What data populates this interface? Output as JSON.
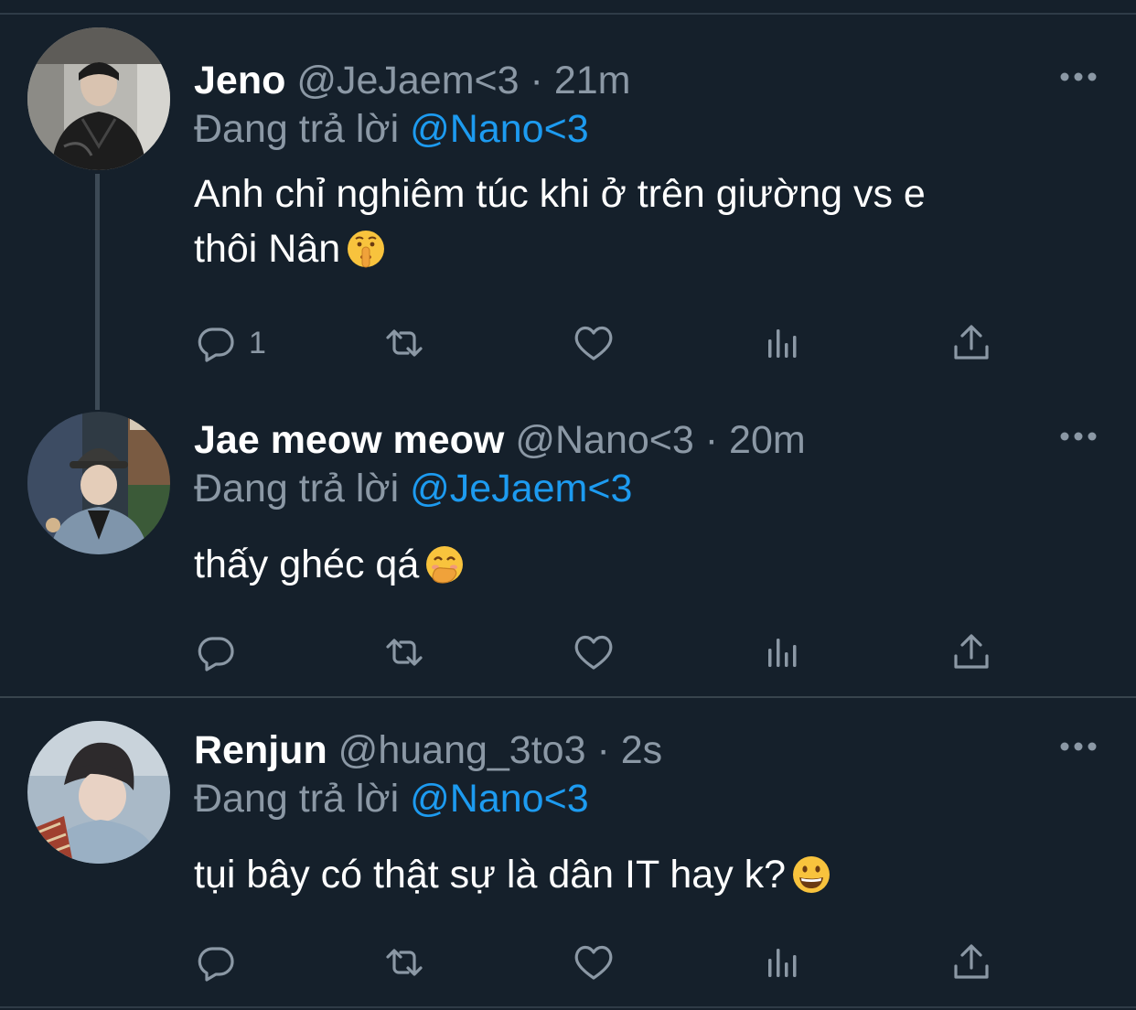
{
  "tweets": [
    {
      "name": "Jeno",
      "handle": "@JeJaem<3",
      "separator": "·",
      "time": "21m",
      "reply_prefix": "Đang trả lời",
      "reply_to": "@Nano<3",
      "text_line1": "Anh chỉ nghiêm túc khi ở trên giường vs e",
      "text_line2": "thôi Nân",
      "emoji": "shushing-face",
      "reply_count": "1"
    },
    {
      "name": "Jae meow meow",
      "handle": "@Nano<3",
      "separator": "·",
      "time": "20m",
      "reply_prefix": "Đang trả lời",
      "reply_to": "@JeJaem<3",
      "text_line1": "thấy ghéc qá",
      "emoji": "face-with-hand-over-mouth",
      "reply_count": ""
    },
    {
      "name": "Renjun",
      "handle": "@huang_3to3",
      "separator": "·",
      "time": "2s",
      "reply_prefix": "Đang trả lời",
      "reply_to": "@Nano<3",
      "text_line1": "tụi bây có thật sự là dân IT hay k?",
      "emoji": "grinning-face",
      "reply_count": ""
    }
  ],
  "colors": {
    "background": "#15202b",
    "secondary_text": "#8b98a5",
    "accent": "#1d9bf0",
    "divider": "#38444d"
  },
  "icons": [
    "more-icon",
    "reply-icon",
    "retweet-icon",
    "like-icon",
    "analytics-icon",
    "share-icon"
  ]
}
